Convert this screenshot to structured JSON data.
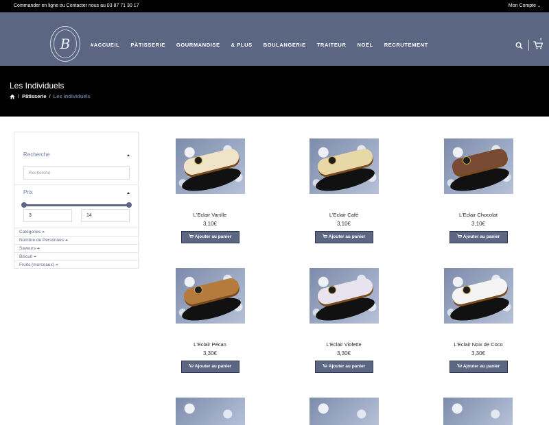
{
  "topbar": {
    "contact": "Commander en ligne ou Contacter nous au 03 87 71 30 17",
    "account": "Mon Compte"
  },
  "header": {
    "logo_letter": "B",
    "nav": [
      "ACCUEIL",
      "PÂTISSERIE",
      "GOURMANDISE",
      "& PLUS",
      "BOULANGERIE",
      "TRAITEUR",
      "NOËL",
      "RECRUTEMENT"
    ],
    "cart_count": "0"
  },
  "banner": {
    "title": "Les Individuels",
    "breadcrumb": [
      "Pâtisserie",
      "Les Individuels"
    ]
  },
  "sidebar": {
    "search_heading": "Recherche",
    "search_placeholder": "Recherche",
    "price_heading": "Prix",
    "price_min": "3",
    "price_max": "14",
    "facets": [
      "Catégories",
      "Nombre de Personnes",
      "Saveurs",
      "Biscuit",
      "Fruits (morceaux)"
    ]
  },
  "products": [
    {
      "name": "L'Eclair Vanille",
      "price": "3,10€",
      "button": "Ajouter au panier",
      "glaze": "#efe4c8"
    },
    {
      "name": "L'Eclair Café",
      "price": "3,10€",
      "button": "Ajouter au panier",
      "glaze": "#e8d8a8"
    },
    {
      "name": "L'Eclair Chocolat",
      "price": "3,10€",
      "button": "Ajouter au panier",
      "glaze": "#7a4b34"
    },
    {
      "name": "L'Eclair Pécan",
      "price": "3,30€",
      "button": "Ajouter au panier",
      "glaze": "#b57a3e"
    },
    {
      "name": "L'Eclair Violette",
      "price": "3,30€",
      "button": "Ajouter au panier",
      "glaze": "#e9e3f0"
    },
    {
      "name": "L'Eclair Noix de Coco",
      "price": "3,30€",
      "button": "Ajouter au panier",
      "glaze": "#f4f4f4"
    }
  ],
  "colors": {
    "brand": "#5b6682",
    "topbar": "#000000",
    "banner": "#000000",
    "breadcrumb_current": "#6d7aa0"
  }
}
